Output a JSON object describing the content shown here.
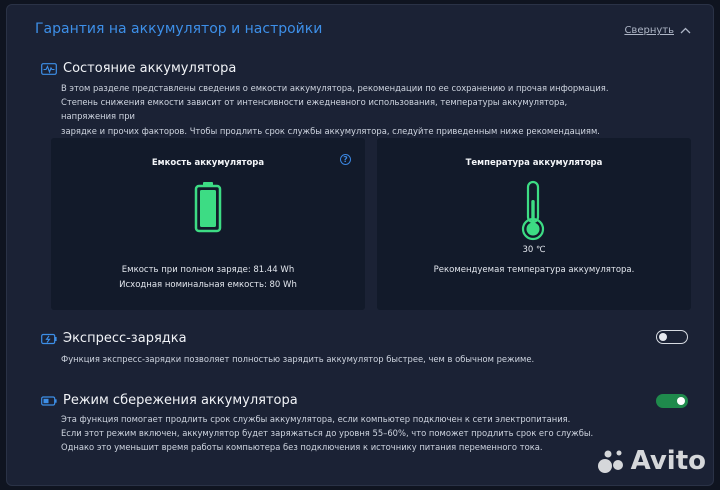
{
  "header": {
    "title": "Гарантия на аккумулятор и настройки",
    "collapse_label": "Свернуть"
  },
  "battery_status": {
    "title": "Состояние аккумулятора",
    "desc_lines": [
      "В этом разделе представлены сведения о емкости аккумулятора, рекомендации по ее сохранению и прочая информация.",
      "Степень снижения емкости зависит от интенсивности ежедневного использования, температуры аккумулятора, напряжения при",
      "зарядке и прочих факторов. Чтобы продлить срок службы аккумулятора, следуйте приведенным ниже рекомендациям."
    ]
  },
  "capacity_card": {
    "title": "Емкость аккумулятора",
    "help_glyph": "?",
    "full_charge": "Емкость при полном заряде: 81.44 Wh",
    "design": "Исходная номинальная емкость: 80 Wh",
    "fill_fraction": 1.0,
    "fill_color": "#3ddc84"
  },
  "temperature_card": {
    "title": "Температура аккумулятора",
    "value": "30 ℃",
    "note": "Рекомендуемая температура аккумулятора.",
    "thermo_color": "#3ddc84"
  },
  "express_charge": {
    "title": "Экспресс-зарядка",
    "desc": "Функция экспресс-зарядки позволяет полностью зарядить аккумулятор быстрее, чем в обычном режиме.",
    "enabled": false
  },
  "battery_saver": {
    "title": "Режим сбережения аккумулятора",
    "desc_lines": [
      "Эта функция помогает продлить срок службы аккумулятора, если компьютер подключен к сети электропитания.",
      "Если этот режим включен, аккумулятор будет заряжаться до уровня 55–60%, что поможет продлить срок его службы.",
      "Однако это уменьшит время работы компьютера без подключения к источнику питания переменного тока."
    ],
    "enabled": true
  },
  "watermark": {
    "text": "Avito"
  },
  "colors": {
    "accent": "#3d8fe8",
    "toggle_on": "#1f8a4c",
    "battery_green": "#3ddc84"
  }
}
